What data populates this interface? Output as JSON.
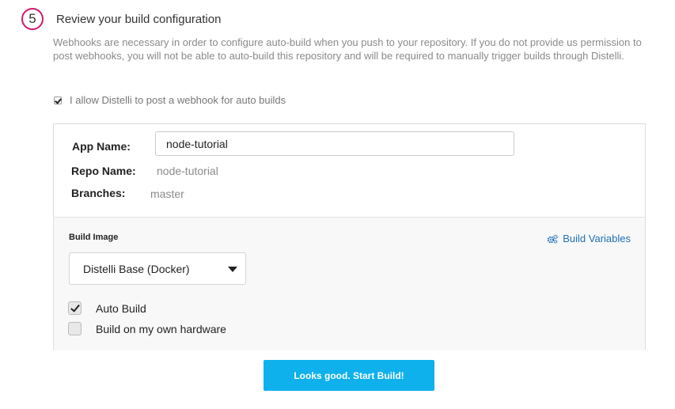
{
  "step": {
    "number": "5",
    "title": "Review your build configuration"
  },
  "intro_text": "Webhooks are necessary in order to configure auto-build when you push to your repository. If you do not provide us permission to post webhooks, you will not be able to auto-build this repository and will be required to manually trigger builds through Distelli.",
  "webhook": {
    "checked": true,
    "label": "I allow Distelli to post a webhook for auto builds"
  },
  "app": {
    "app_name_label": "App Name:",
    "app_name_value": "node-tutorial",
    "repo_name_label": "Repo Name:",
    "repo_name_value": "node-tutorial",
    "branches_label": "Branches:",
    "branches_value": "master"
  },
  "build": {
    "image_label": "Build Image",
    "variables_link": "Build Variables",
    "variables_icon": "gears-icon",
    "image_selected": "Distelli Base (Docker)",
    "auto_build_label": "Auto Build",
    "auto_build_checked": true,
    "own_hardware_label": "Build on my own hardware",
    "own_hardware_checked": false
  },
  "actions": {
    "start_label": "Looks good. Start Build!"
  },
  "colors": {
    "badge": "#d6186c",
    "link": "#1f6fb5",
    "primary_button": "#0eb1ec"
  }
}
